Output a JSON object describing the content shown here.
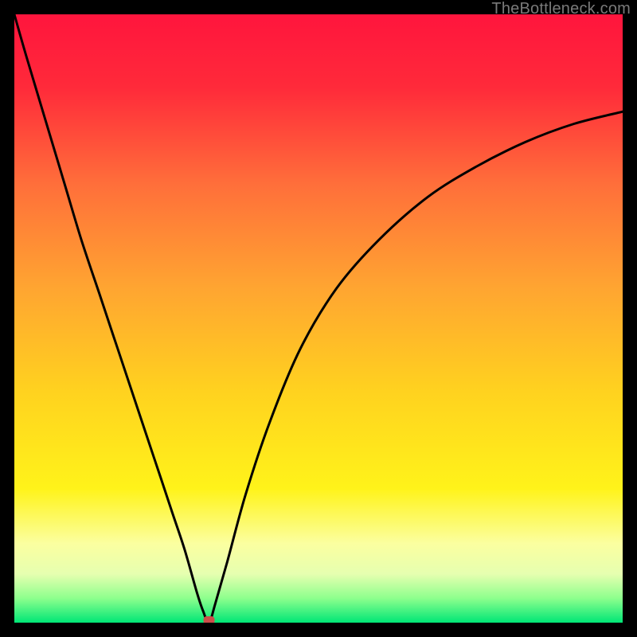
{
  "watermark": "TheBottleneck.com",
  "chart_data": {
    "type": "line",
    "title": "",
    "xlabel": "",
    "ylabel": "",
    "xlim": [
      0,
      100
    ],
    "ylim": [
      0,
      100
    ],
    "grid": false,
    "legend": false,
    "gradient": {
      "description": "vertical background from red at top through orange, yellow, pale yellow to bright green at bottom",
      "stops": [
        {
          "pos": 0.0,
          "color": "#ff153d"
        },
        {
          "pos": 0.12,
          "color": "#ff2a3a"
        },
        {
          "pos": 0.28,
          "color": "#ff6f3a"
        },
        {
          "pos": 0.45,
          "color": "#ffa531"
        },
        {
          "pos": 0.62,
          "color": "#ffd21f"
        },
        {
          "pos": 0.78,
          "color": "#fff31a"
        },
        {
          "pos": 0.87,
          "color": "#fbffa0"
        },
        {
          "pos": 0.92,
          "color": "#e6ffb0"
        },
        {
          "pos": 0.96,
          "color": "#8dff8d"
        },
        {
          "pos": 1.0,
          "color": "#00e676"
        }
      ]
    },
    "curve": {
      "description": "V-shaped bottleneck curve; steep descent from top-left, minimum near x≈32, rises toward upper-right with diminishing slope",
      "x": [
        0,
        2,
        5,
        8,
        11,
        14,
        17,
        20,
        23,
        26,
        28,
        30,
        31,
        32,
        33,
        35,
        38,
        42,
        47,
        53,
        60,
        68,
        76,
        84,
        92,
        100
      ],
      "y": [
        100,
        93,
        83,
        73,
        63,
        54,
        45,
        36,
        27,
        18,
        12,
        5,
        2,
        0,
        3,
        10,
        21,
        33,
        45,
        55,
        63,
        70,
        75,
        79,
        82,
        84
      ]
    },
    "marker": {
      "description": "small rounded red marker at curve minimum",
      "x": 32,
      "y": 0,
      "color": "#cc4f4a"
    }
  }
}
